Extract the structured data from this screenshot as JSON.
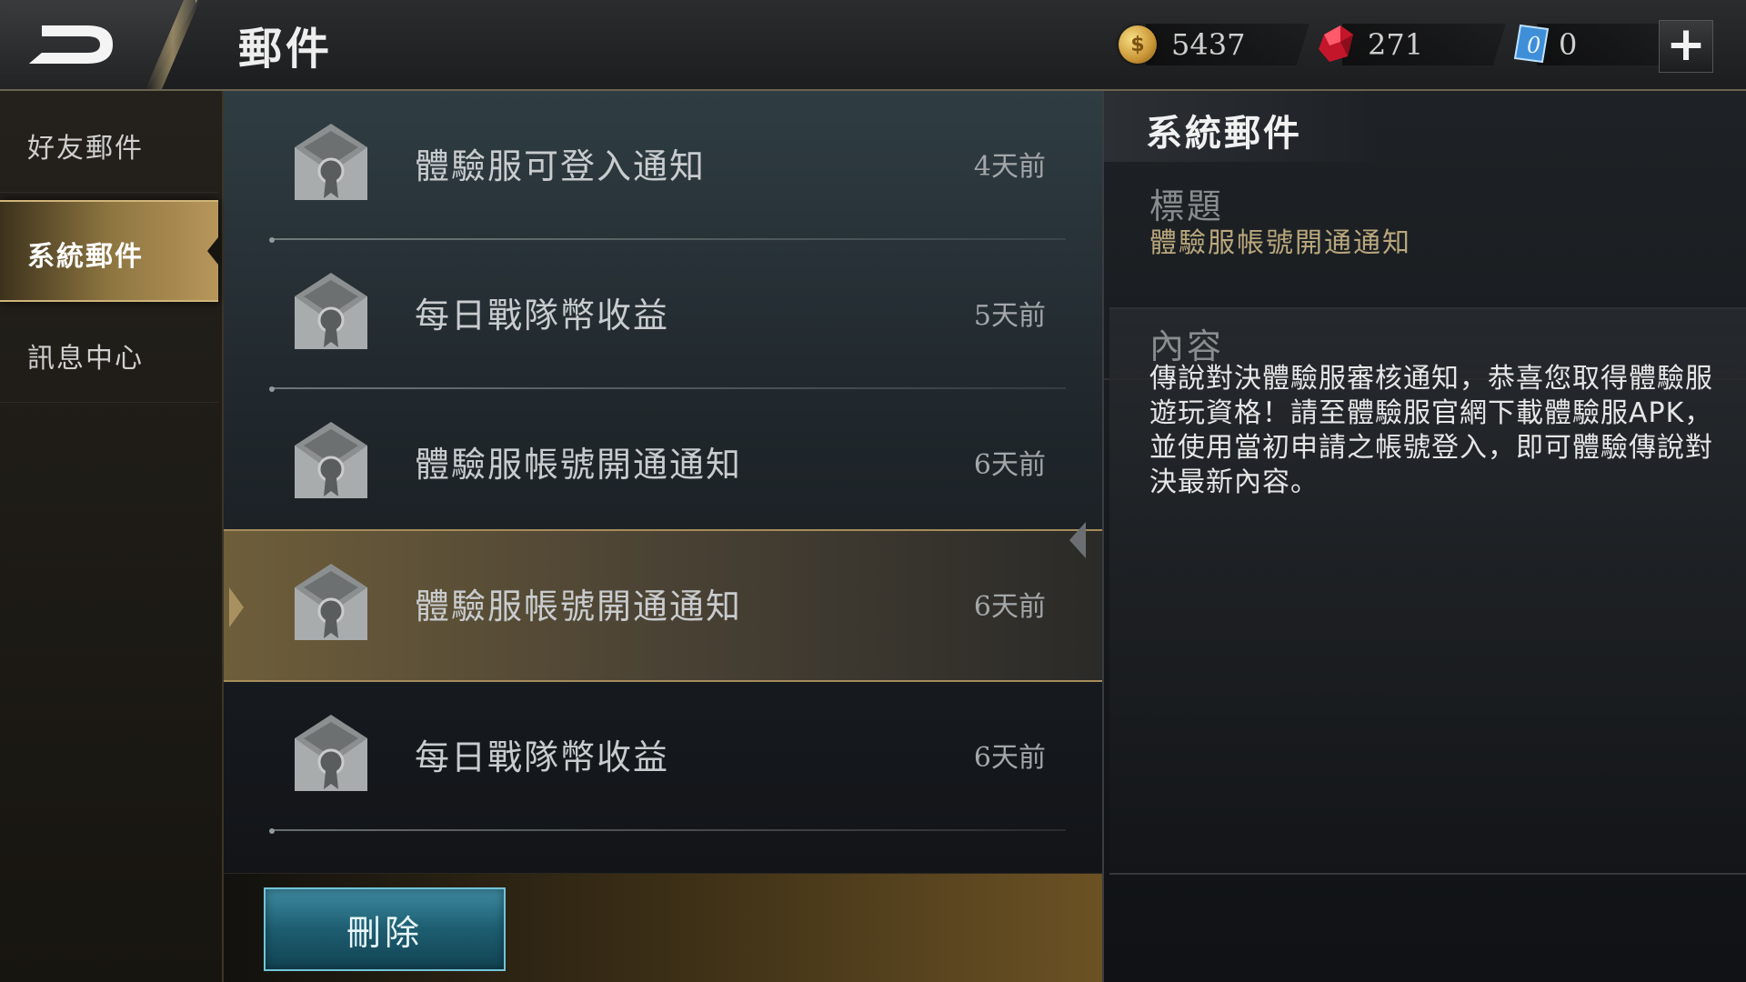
{
  "header": {
    "title": "郵件",
    "currencies": {
      "gold": "5437",
      "diamond": "271",
      "voucher": "0"
    },
    "add_label": "+"
  },
  "sidebar": {
    "items": [
      {
        "label": "好友郵件",
        "active": false
      },
      {
        "label": "系統郵件",
        "active": true
      },
      {
        "label": "訊息中心",
        "active": false
      }
    ]
  },
  "mail_list": [
    {
      "title": "體驗服可登入通知",
      "time": "4天前"
    },
    {
      "title": "每日戰隊幣收益",
      "time": "5天前"
    },
    {
      "title": "體驗服帳號開通通知",
      "time": "6天前"
    },
    {
      "title": "體驗服帳號開通通知",
      "time": "6天前",
      "selected": true
    },
    {
      "title": "每日戰隊幣收益",
      "time": "6天前"
    }
  ],
  "actions": {
    "delete_label": "刪除"
  },
  "detail": {
    "heading": "系統郵件",
    "subject_label": "標題",
    "subject_value": "體驗服帳號開通通知",
    "content_label": "內容",
    "content_text": "傳說對決體驗服審核通知，恭喜您取得體驗服遊玩資格！請至體驗服官網下載體驗服APK，並使用當初申請之帳號登入，即可體驗傳說對決最新內容。"
  }
}
